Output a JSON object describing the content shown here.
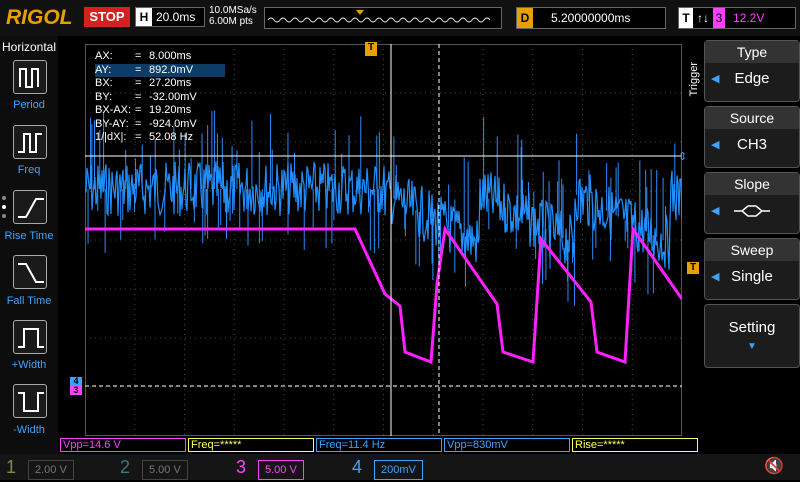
{
  "brand": "RIGOL",
  "status": "STOP",
  "horizontal": {
    "label": "H",
    "timebase": "20.0ms",
    "sample_rate": "10.0MSa/s",
    "points": "6.00M pts"
  },
  "trigger_delay": {
    "label": "D",
    "value": "5.20000000ms"
  },
  "trigger": {
    "label": "T",
    "channel_num": "3",
    "level": "12.2V"
  },
  "left_panel": {
    "title": "Horizontal",
    "items": [
      {
        "label": "Period",
        "icon": "period-icon"
      },
      {
        "label": "Freq",
        "icon": "freq-icon"
      },
      {
        "label": "Rise Time",
        "icon": "rise-time-icon"
      },
      {
        "label": "Fall Time",
        "icon": "fall-time-icon"
      },
      {
        "label": "+Width",
        "icon": "positive-width-icon"
      },
      {
        "label": "-Width",
        "icon": "negative-width-icon"
      }
    ]
  },
  "cursor_readout": [
    {
      "key": "AX:",
      "value": "8.000ms"
    },
    {
      "key": "AY:",
      "value": "892.0mV"
    },
    {
      "key": "BX:",
      "value": "27.20ms"
    },
    {
      "key": "BY:",
      "value": "-32.00mV"
    },
    {
      "key": "BX-AX:",
      "value": "19.20ms"
    },
    {
      "key": "BY-AY:",
      "value": "-924.0mV"
    },
    {
      "key": "1/|dX|:",
      "value": "52.08 Hz"
    }
  ],
  "trigger_menu": {
    "side_label": "Trigger",
    "type": {
      "title": "Type",
      "value": "Edge"
    },
    "source": {
      "title": "Source",
      "value": "CH3"
    },
    "slope": {
      "title": "Slope"
    },
    "sweep": {
      "title": "Sweep",
      "value": "Single"
    },
    "setting": {
      "title": "Setting"
    }
  },
  "markers": {
    "trigger_pos": "T",
    "trigger_level": "T",
    "ch3_marker": "3",
    "ch4_marker": "4"
  },
  "measurements": [
    {
      "text": "Vpp=14.6 V",
      "color": "#ff40ff"
    },
    {
      "text": "Freq=*****",
      "color": "#ffff60"
    },
    {
      "text": "Freq=11.4 Hz",
      "color": "#3ea3ff"
    },
    {
      "text": "Vpp=830mV",
      "color": "#3ea3ff"
    },
    {
      "text": "Rise=*****",
      "color": "#ffff60"
    }
  ],
  "channels": [
    {
      "num": "1",
      "scale": "2.00 V",
      "color": "#8a8a3a"
    },
    {
      "num": "2",
      "scale": "5.00 V",
      "color": "#3a7a7a"
    },
    {
      "num": "3",
      "scale": "5.00 V",
      "color": "#ff40ff"
    },
    {
      "num": "4",
      "scale": "200mV",
      "color": "#3ea3ff"
    }
  ],
  "colors": {
    "ch3": "#ff20ff",
    "ch4": "#1e90ff",
    "accent": "#e8a000",
    "cursor": "#ffffff"
  }
}
